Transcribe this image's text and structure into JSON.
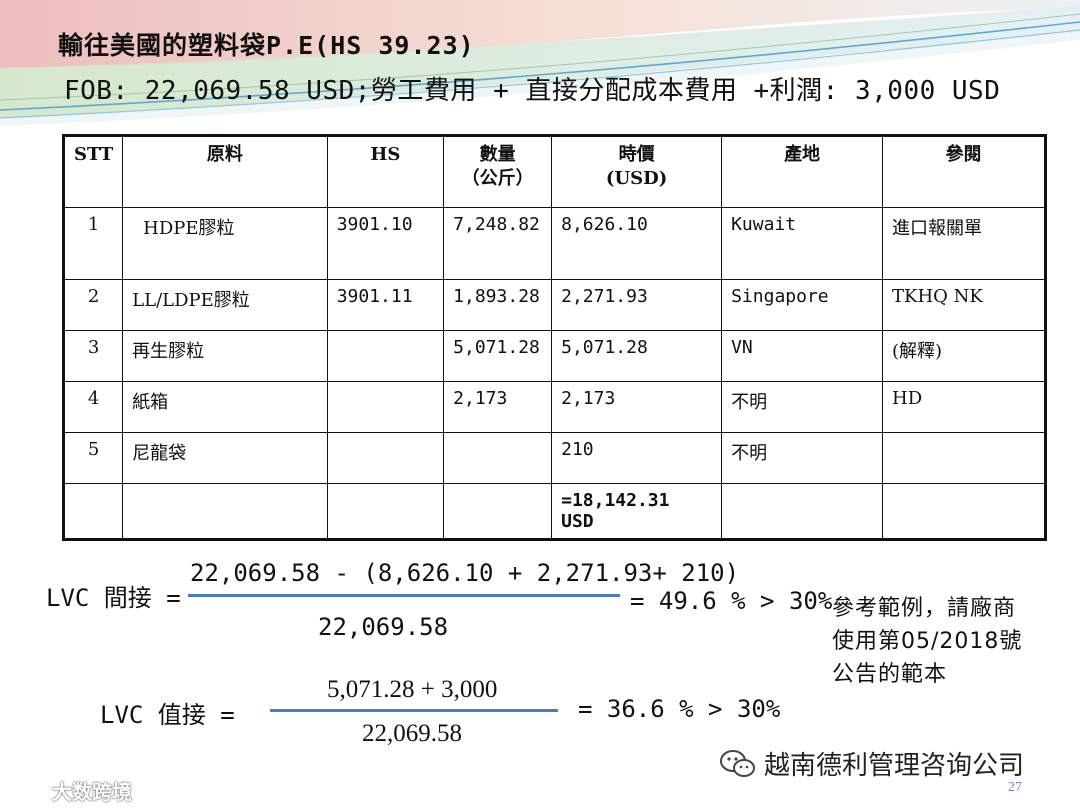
{
  "slide": {
    "title": "輸往美國的塑料袋P.E(HS 39.23)",
    "subtitle": "FOB: 22,069.58 USD;勞工費用 + 直接分配成本費用 +利潤: 3,000 USD",
    "page_number": "27"
  },
  "table": {
    "headers": {
      "stt": "STT",
      "material": "原料",
      "hs": "HS",
      "qty_1": "數量",
      "qty_2": "（公斤）",
      "price_1": "時價",
      "price_2": "(USD)",
      "origin": "產地",
      "ref": "參閱"
    },
    "rows": [
      {
        "stt": "1",
        "material": "HDPE膠粒",
        "hs": "3901.10",
        "qty": "7,248.82",
        "price": "8,626.10",
        "origin": "Kuwait",
        "ref": "進口報關單"
      },
      {
        "stt": "2",
        "material": "LL/LDPE膠粒",
        "hs": "3901.11",
        "qty": "1,893.28",
        "price": "2,271.93",
        "origin": "Singapore",
        "ref": "TKHQ NK"
      },
      {
        "stt": "3",
        "material": "再生膠粒",
        "hs": "",
        "qty": "5,071.28",
        "price": "5,071.28",
        "origin": "VN",
        "ref": "(解釋)"
      },
      {
        "stt": "4",
        "material": "紙箱",
        "hs": "",
        "qty": "2,173",
        "price": "2,173",
        "origin": "不明",
        "ref": "HD"
      },
      {
        "stt": "5",
        "material": "尼龍袋",
        "hs": "",
        "qty": "",
        "price": "210",
        "origin": "不明",
        "ref": ""
      }
    ],
    "total": "=18,142.31 USD"
  },
  "formula1": {
    "label": "LVC 間接 =",
    "numerator": "22,069.58 -  (8,626.10 + 2,271.93+ 210)",
    "denominator": "22,069.58",
    "result": "= 49.6 % > 30%"
  },
  "formula2": {
    "label": "LVC 值接 =",
    "numerator": "5,071.28 + 3,000",
    "denominator": "22,069.58",
    "result": "= 36.6 % > 30%"
  },
  "note": {
    "line1": "參考範例，請廠商",
    "line2": "使用第05/2018號",
    "line3": "公告的範本"
  },
  "watermark": {
    "right_text": "越南德利管理咨询公司",
    "left_text": "大数跨境"
  },
  "colors": {
    "fraction_line": "#4a7cc0",
    "page_number": "#6a8db5"
  }
}
